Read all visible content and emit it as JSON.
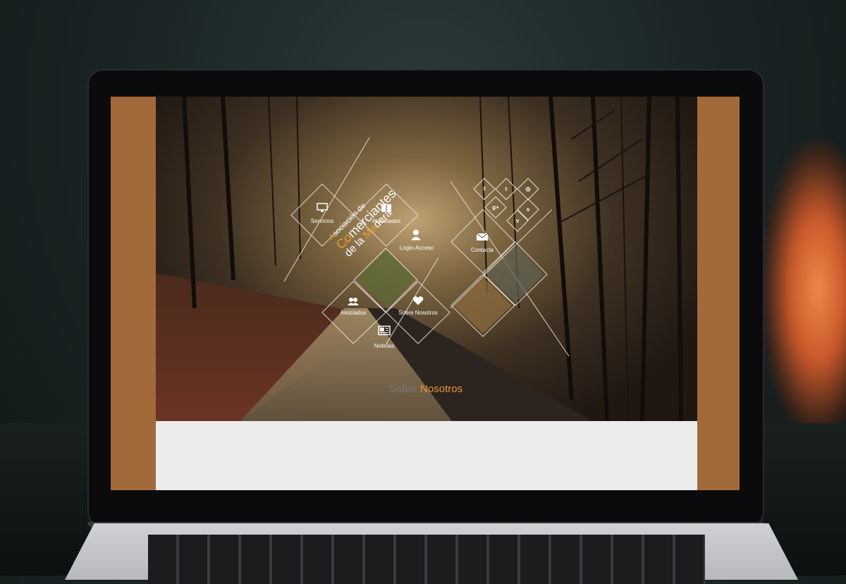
{
  "site": {
    "brand": {
      "line1_initial": "A",
      "line1_rest": "sociación de",
      "line2_initial": "Co",
      "line2_rest": "merciantes",
      "line3_start": "de la ",
      "line3_initial": "Ma",
      "line3_rest": "dera"
    },
    "nav": [
      {
        "label": "Servicios",
        "icon": "monitor-icon"
      },
      {
        "label": "Actividades",
        "icon": "book-icon"
      },
      {
        "label": "Login-Acceso",
        "icon": "user-login-icon"
      },
      {
        "label": "Asociados",
        "icon": "users-icon"
      },
      {
        "label": "Sobre Nosotros",
        "icon": "heart-icon"
      },
      {
        "label": "Noticias",
        "icon": "newspaper-icon"
      },
      {
        "label": "Contacta",
        "icon": "envelope-icon"
      }
    ],
    "social": [
      {
        "glyph": "f",
        "icon": "facebook-icon"
      },
      {
        "glyph": "t",
        "icon": "twitter-icon"
      },
      {
        "glyph": "◎",
        "icon": "dribbble-icon"
      },
      {
        "glyph": "g+",
        "icon": "google-plus-icon"
      },
      {
        "glyph": "s",
        "icon": "skype-icon"
      },
      {
        "glyph": "v",
        "icon": "vimeo-icon"
      }
    ],
    "section_title": {
      "part1": "Sobre ",
      "part2": "Nosotros"
    },
    "colors": {
      "accent": "#e4962e",
      "frame": "#a2693a",
      "content_bg": "#ececec"
    }
  }
}
